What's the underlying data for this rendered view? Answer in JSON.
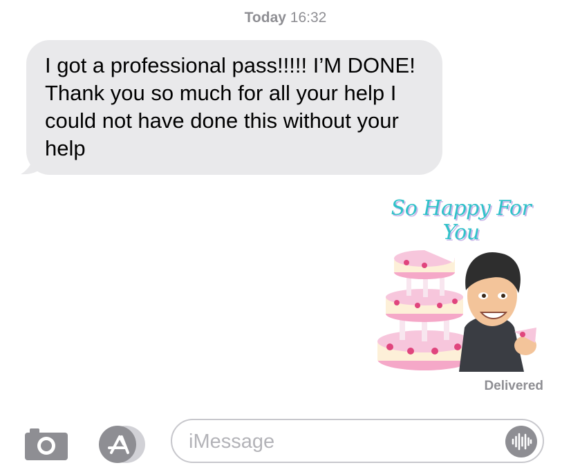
{
  "header": {
    "timestamp_day": "Today",
    "timestamp_time": "16:32"
  },
  "messages": [
    {
      "direction": "incoming",
      "text": "I got a professional pass!!!!! I’M DONE! Thank you so much for all your help I could not have done this without your help"
    }
  ],
  "sticker": {
    "caption": "So Happy For You",
    "icon": "bitmoji-cake-sticker"
  },
  "status": {
    "delivered_label": "Delivered"
  },
  "compose": {
    "placeholder": "iMessage",
    "icons": [
      "camera-icon",
      "app-store-icon",
      "audio-waveform-icon"
    ]
  },
  "colors": {
    "incoming_bubble": "#e9e9eb",
    "meta_text": "#8e8e93",
    "sticker_caption": "#2fc2c9"
  }
}
